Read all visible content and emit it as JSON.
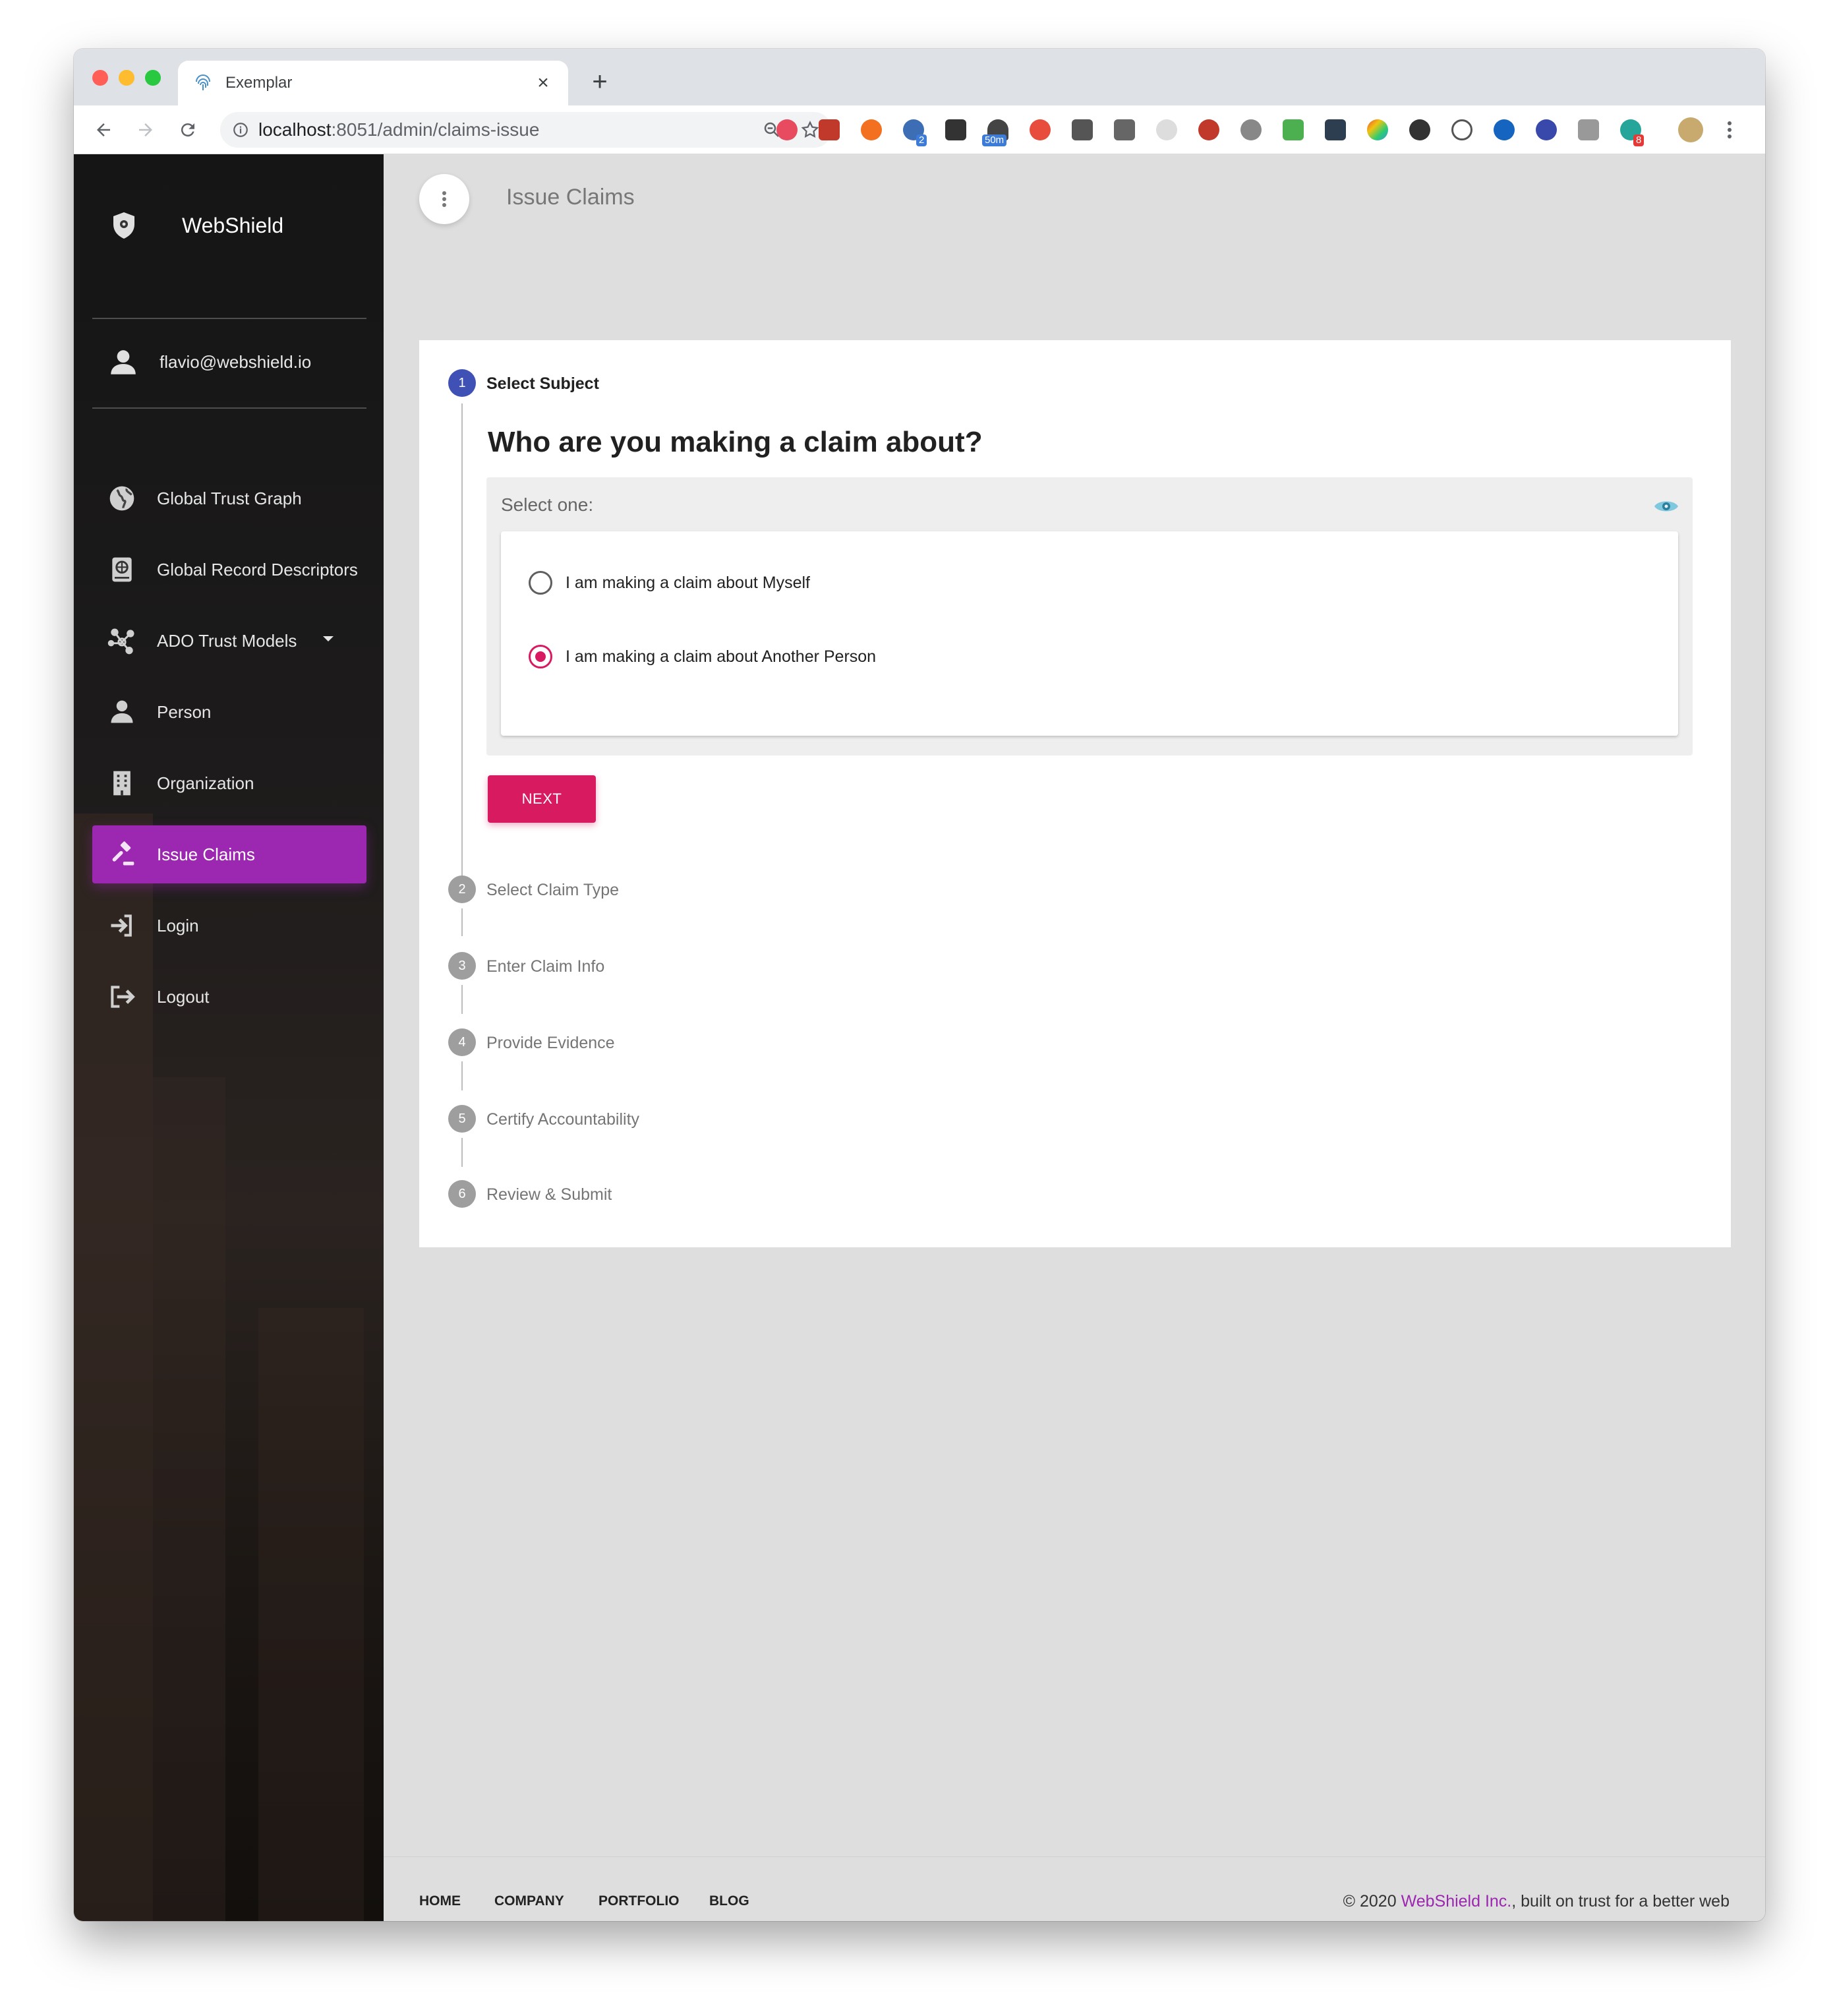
{
  "browser": {
    "tab_title": "Exemplar",
    "url_host": "localhost",
    "url_rest": ":8051/admin/claims-issue",
    "extension_badges": {
      "ext_a": "2",
      "ext_b": "50m",
      "ext_c": "8"
    }
  },
  "sidebar": {
    "brand": "WebShield",
    "user_email": "flavio@webshield.io",
    "items": [
      {
        "label": "Global Trust Graph",
        "icon": "globe-icon"
      },
      {
        "label": "Global Record Descriptors",
        "icon": "book-globe-icon"
      },
      {
        "label": "ADO Trust Models",
        "icon": "network-icon"
      },
      {
        "label": "Person",
        "icon": "person-icon"
      },
      {
        "label": "Organization",
        "icon": "building-icon"
      },
      {
        "label": "Issue Claims",
        "icon": "gavel-icon"
      },
      {
        "label": "Login",
        "icon": "login-icon"
      },
      {
        "label": "Logout",
        "icon": "logout-icon"
      }
    ]
  },
  "header": {
    "title": "Issue Claims"
  },
  "stepper": {
    "steps": [
      {
        "number": "1",
        "label": "Select Subject"
      },
      {
        "number": "2",
        "label": "Select Claim Type"
      },
      {
        "number": "3",
        "label": "Enter Claim Info"
      },
      {
        "number": "4",
        "label": "Provide Evidence"
      },
      {
        "number": "5",
        "label": "Certify Accountability"
      },
      {
        "number": "6",
        "label": "Review & Submit"
      }
    ],
    "question": "Who are you making a claim about?",
    "select_label": "Select one:",
    "options": [
      {
        "label": "I am making a claim about Myself",
        "checked": false
      },
      {
        "label": "I am making a claim about Another Person",
        "checked": true
      }
    ],
    "next_label": "NEXT"
  },
  "footer": {
    "links": [
      "HOME",
      "COMPANY",
      "PORTFOLIO",
      "BLOG"
    ],
    "copyright_prefix": "© 2020 ",
    "copyright_brand": "WebShield Inc.",
    "copyright_suffix": ", built on trust for a better web"
  },
  "colors": {
    "accent": "#9c27b0",
    "primary_button": "#d81b60",
    "active_step": "#3f51b5"
  }
}
